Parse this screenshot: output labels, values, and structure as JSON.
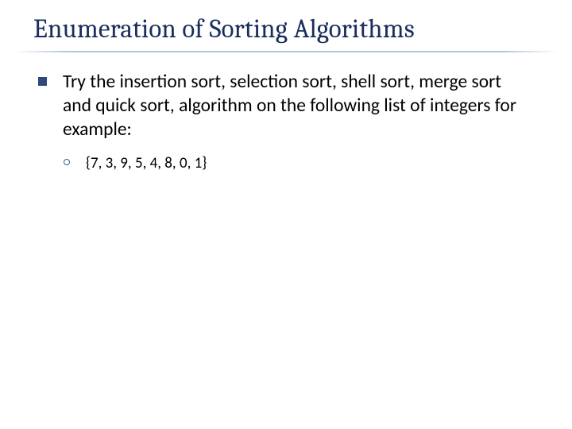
{
  "slide": {
    "title": "Enumeration of Sorting Algorithms",
    "bullet1": "Try the insertion sort, selection sort, shell sort, merge sort and quick sort,  algorithm on the following list of integers for example:",
    "subbullet1": "{7, 3, 9, 5, 4, 8, 0, 1}"
  }
}
